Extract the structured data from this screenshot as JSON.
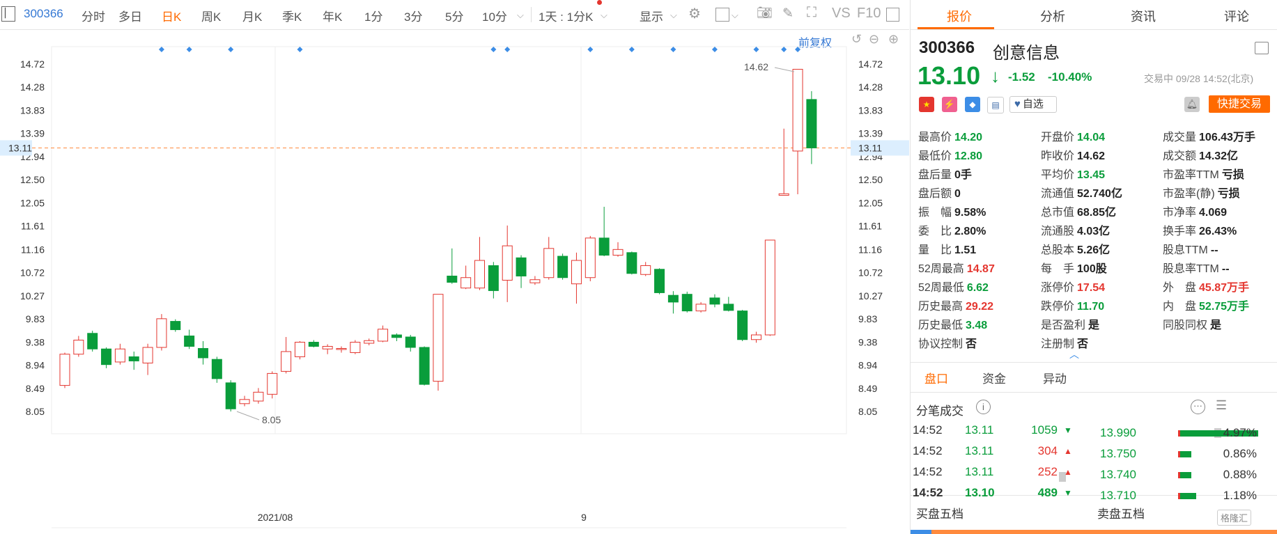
{
  "toolbar": {
    "stock_code": "300366",
    "periods": [
      "分时",
      "多日",
      "日K",
      "周K",
      "月K",
      "季K",
      "年K",
      "1分",
      "3分",
      "5分",
      "10分"
    ],
    "active_period": "日K",
    "interval_select": "1天 : 1分K",
    "display_label": "显示",
    "vs_label": "VS",
    "f10_label": "F10"
  },
  "chart": {
    "adjust_label": "前复权",
    "price_ticks": [
      "14.72",
      "14.28",
      "13.83",
      "13.39",
      "12.94",
      "12.50",
      "12.05",
      "11.61",
      "11.16",
      "10.72",
      "10.27",
      "9.83",
      "9.38",
      "8.94",
      "8.49",
      "8.05"
    ],
    "current_price_tag": "13.11",
    "date_labels": [
      "2021/08",
      "9"
    ],
    "high_annotation": "14.62",
    "low_annotation": "8.05",
    "colors": {
      "up": "#e4362f",
      "down": "#0a9d3b",
      "ref_line": "#ff8a3d",
      "marker": "#3c8de6"
    }
  },
  "chart_data": {
    "type": "candlestick",
    "ylim": [
      7.9,
      15.0
    ],
    "current_price": 13.11,
    "candles": [
      {
        "o": 8.55,
        "c": 9.15,
        "h": 9.18,
        "l": 8.5
      },
      {
        "o": 9.15,
        "c": 9.42,
        "h": 9.5,
        "l": 9.1
      },
      {
        "o": 9.55,
        "c": 9.25,
        "h": 9.6,
        "l": 9.2
      },
      {
        "o": 9.25,
        "c": 8.95,
        "h": 9.28,
        "l": 8.88
      },
      {
        "o": 9.0,
        "c": 9.25,
        "h": 9.35,
        "l": 8.95
      },
      {
        "o": 9.1,
        "c": 9.02,
        "h": 9.2,
        "l": 8.85
      },
      {
        "o": 8.98,
        "c": 9.28,
        "h": 9.35,
        "l": 8.75
      },
      {
        "o": 9.28,
        "c": 9.83,
        "h": 9.92,
        "l": 9.22
      },
      {
        "o": 9.78,
        "c": 9.62,
        "h": 9.82,
        "l": 9.58
      },
      {
        "o": 9.5,
        "c": 9.3,
        "h": 9.62,
        "l": 9.25
      },
      {
        "o": 9.26,
        "c": 9.08,
        "h": 9.4,
        "l": 8.95
      },
      {
        "o": 9.05,
        "c": 8.68,
        "h": 9.1,
        "l": 8.6
      },
      {
        "o": 8.6,
        "c": 8.1,
        "h": 8.65,
        "l": 8.05
      },
      {
        "o": 8.2,
        "c": 8.28,
        "h": 8.35,
        "l": 8.15
      },
      {
        "o": 8.25,
        "c": 8.42,
        "h": 8.5,
        "l": 8.2
      },
      {
        "o": 8.38,
        "c": 8.78,
        "h": 8.82,
        "l": 8.3
      },
      {
        "o": 8.82,
        "c": 9.2,
        "h": 9.48,
        "l": 8.78
      },
      {
        "o": 9.1,
        "c": 9.38,
        "h": 9.4,
        "l": 9.05
      },
      {
        "o": 9.38,
        "c": 9.3,
        "h": 9.42,
        "l": 9.28
      },
      {
        "o": 9.25,
        "c": 9.3,
        "h": 9.34,
        "l": 9.15
      },
      {
        "o": 9.25,
        "c": 9.26,
        "h": 9.3,
        "l": 9.18
      },
      {
        "o": 9.18,
        "c": 9.38,
        "h": 9.42,
        "l": 9.15
      },
      {
        "o": 9.36,
        "c": 9.41,
        "h": 9.45,
        "l": 9.32
      },
      {
        "o": 9.4,
        "c": 9.63,
        "h": 9.7,
        "l": 9.38
      },
      {
        "o": 9.52,
        "c": 9.47,
        "h": 9.55,
        "l": 9.4
      },
      {
        "o": 9.48,
        "c": 9.28,
        "h": 9.52,
        "l": 9.2
      },
      {
        "o": 9.28,
        "c": 8.57,
        "h": 9.3,
        "l": 8.55
      },
      {
        "o": 8.63,
        "c": 10.3,
        "h": 10.3,
        "l": 8.45
      },
      {
        "o": 10.65,
        "c": 10.53,
        "h": 11.18,
        "l": 10.5
      },
      {
        "o": 10.42,
        "c": 10.62,
        "h": 10.85,
        "l": 10.4
      },
      {
        "o": 10.42,
        "c": 10.95,
        "h": 11.4,
        "l": 10.38
      },
      {
        "o": 10.85,
        "c": 10.37,
        "h": 10.92,
        "l": 10.22
      },
      {
        "o": 10.57,
        "c": 11.23,
        "h": 11.62,
        "l": 10.15
      },
      {
        "o": 11.0,
        "c": 10.65,
        "h": 11.05,
        "l": 10.42
      },
      {
        "o": 10.52,
        "c": 10.58,
        "h": 10.65,
        "l": 10.48
      },
      {
        "o": 10.62,
        "c": 11.18,
        "h": 11.4,
        "l": 10.58
      },
      {
        "o": 11.03,
        "c": 10.62,
        "h": 11.08,
        "l": 10.58
      },
      {
        "o": 10.5,
        "c": 10.95,
        "h": 11.1,
        "l": 10.12
      },
      {
        "o": 10.62,
        "c": 11.38,
        "h": 11.42,
        "l": 10.55
      },
      {
        "o": 11.38,
        "c": 11.05,
        "h": 11.98,
        "l": 11.03
      },
      {
        "o": 11.05,
        "c": 11.16,
        "h": 11.3,
        "l": 11.02
      },
      {
        "o": 11.1,
        "c": 10.7,
        "h": 11.12,
        "l": 10.68
      },
      {
        "o": 10.68,
        "c": 10.85,
        "h": 10.92,
        "l": 10.65
      },
      {
        "o": 10.78,
        "c": 10.33,
        "h": 10.8,
        "l": 10.3
      },
      {
        "o": 10.28,
        "c": 10.15,
        "h": 10.36,
        "l": 9.93
      },
      {
        "o": 10.3,
        "c": 9.98,
        "h": 10.35,
        "l": 9.95
      },
      {
        "o": 9.98,
        "c": 10.11,
        "h": 10.15,
        "l": 9.95
      },
      {
        "o": 10.23,
        "c": 10.11,
        "h": 10.3,
        "l": 10.05
      },
      {
        "o": 10.11,
        "c": 9.99,
        "h": 10.25,
        "l": 9.97
      },
      {
        "o": 9.98,
        "c": 9.43,
        "h": 10.0,
        "l": 9.4
      },
      {
        "o": 9.43,
        "c": 9.52,
        "h": 9.58,
        "l": 9.37
      },
      {
        "o": 9.52,
        "c": 11.34,
        "h": 11.34,
        "l": 9.5
      },
      {
        "o": 12.2,
        "c": 12.23,
        "h": 13.48,
        "l": 12.2
      },
      {
        "o": 13.05,
        "c": 14.62,
        "h": 14.62,
        "l": 12.22
      },
      {
        "o": 14.04,
        "c": 13.11,
        "h": 14.2,
        "l": 12.8
      }
    ],
    "markers_x_index": [
      7,
      9,
      12,
      17,
      31,
      32,
      38,
      41,
      44,
      47,
      50,
      52,
      53
    ]
  },
  "panel": {
    "tabs": [
      "报价",
      "分析",
      "资讯",
      "评论"
    ],
    "code": "300366",
    "name": "创意信息",
    "price": "13.10",
    "arrow": "↓",
    "change": "-1.52",
    "change_pct": "-10.40%",
    "status_time": "交易中 09/28 14:52(北京)",
    "watch_label": "自选",
    "quick_trade_label": "快捷交易",
    "stats": [
      {
        "k": "最高价",
        "v": "14.20",
        "c": "green"
      },
      {
        "k": "开盘价",
        "v": "14.04",
        "c": "green"
      },
      {
        "k": "成交量",
        "v": "106.43万手",
        "c": ""
      },
      {
        "k": "最低价",
        "v": "12.80",
        "c": "green"
      },
      {
        "k": "昨收价",
        "v": "14.62",
        "c": ""
      },
      {
        "k": "成交额",
        "v": "14.32亿",
        "c": ""
      },
      {
        "k": "盘后量",
        "v": "0手",
        "c": ""
      },
      {
        "k": "平均价",
        "v": "13.45",
        "c": "green"
      },
      {
        "k": "市盈率TTM",
        "v": "亏损",
        "c": ""
      },
      {
        "k": "盘后额",
        "v": "0",
        "c": ""
      },
      {
        "k": "流通值",
        "v": "52.740亿",
        "c": ""
      },
      {
        "k": "市盈率(静)",
        "v": "亏损",
        "c": ""
      },
      {
        "k": "振　幅",
        "v": "9.58%",
        "c": ""
      },
      {
        "k": "总市值",
        "v": "68.85亿",
        "c": ""
      },
      {
        "k": "市净率",
        "v": "4.069",
        "c": ""
      },
      {
        "k": "委　比",
        "v": "2.80%",
        "c": ""
      },
      {
        "k": "流通股",
        "v": "4.03亿",
        "c": ""
      },
      {
        "k": "换手率",
        "v": "26.43%",
        "c": ""
      },
      {
        "k": "量　比",
        "v": "1.51",
        "c": ""
      },
      {
        "k": "总股本",
        "v": "5.26亿",
        "c": ""
      },
      {
        "k": "股息TTM",
        "v": "--",
        "c": ""
      },
      {
        "k": "52周最高",
        "v": "14.87",
        "c": "red"
      },
      {
        "k": "每　手",
        "v": "100股",
        "c": ""
      },
      {
        "k": "股息率TTM",
        "v": "--",
        "c": ""
      },
      {
        "k": "52周最低",
        "v": "6.62",
        "c": "green"
      },
      {
        "k": "涨停价",
        "v": "17.54",
        "c": "red"
      },
      {
        "k": "外　盘",
        "v": "45.87万手",
        "c": "red"
      },
      {
        "k": "历史最高",
        "v": "29.22",
        "c": "red"
      },
      {
        "k": "跌停价",
        "v": "11.70",
        "c": "green"
      },
      {
        "k": "内　盘",
        "v": "52.75万手",
        "c": "green"
      },
      {
        "k": "历史最低",
        "v": "3.48",
        "c": "green"
      },
      {
        "k": "是否盈利",
        "v": "是",
        "c": ""
      },
      {
        "k": "同股同权",
        "v": "是",
        "c": ""
      },
      {
        "k": "协议控制",
        "v": "否",
        "c": ""
      },
      {
        "k": "注册制",
        "v": "否",
        "c": ""
      }
    ],
    "sub_tabs": [
      "盘口",
      "资金",
      "异动"
    ],
    "ticks_title": "分笔成交",
    "ticks": [
      {
        "time": "14:52",
        "price": "13.11",
        "vol": "1059",
        "dir": "down"
      },
      {
        "time": "14:52",
        "price": "13.11",
        "vol": "304",
        "dir": "up"
      },
      {
        "time": "14:52",
        "price": "13.11",
        "vol": "252",
        "dir": "up"
      },
      {
        "time": "14:52",
        "price": "13.10",
        "vol": "489",
        "dir": "down"
      }
    ],
    "depth": [
      {
        "price": "13.990",
        "pct": "4.97%",
        "level": 0.97
      },
      {
        "price": "13.750",
        "pct": "0.86%",
        "level": 0.14
      },
      {
        "price": "13.740",
        "pct": "0.88%",
        "level": 0.14
      },
      {
        "price": "13.710",
        "pct": "1.18%",
        "level": 0.2
      }
    ],
    "buy_five_label": "买盘五档",
    "sell_five_label": "卖盘五档"
  }
}
